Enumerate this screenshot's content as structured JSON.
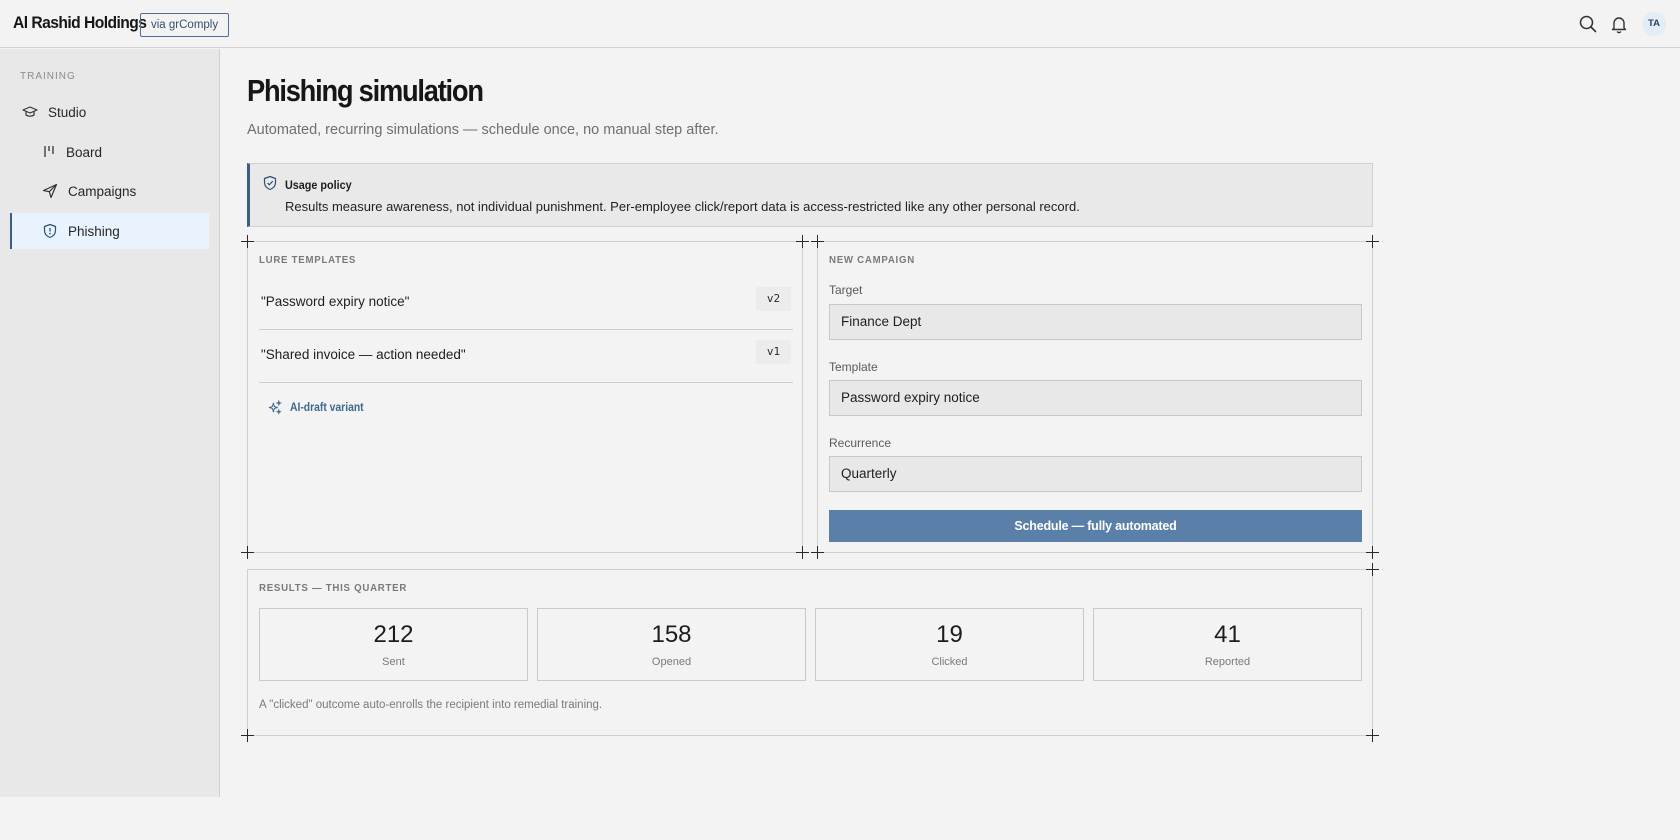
{
  "header": {
    "brand": "Al Rashid Holdings",
    "via_label": "via grComply",
    "avatar_initials": "TA",
    "icons": [
      "search-icon",
      "bell-icon"
    ]
  },
  "sidebar": {
    "section_label": "TRAINING",
    "items": [
      {
        "label": "Studio",
        "icon": "graduation-cap-icon"
      },
      {
        "label": "Board",
        "icon": "kanban-icon"
      },
      {
        "label": "Campaigns",
        "icon": "send-icon"
      },
      {
        "label": "Phishing",
        "icon": "shield-alert-icon",
        "active": true
      }
    ]
  },
  "main": {
    "title": "Phishing simulation",
    "subtitle": "Automated, recurring simulations — schedule once, no manual step after.",
    "policy": {
      "title": "Usage policy",
      "text": "Results measure awareness, not individual punishment. Per-employee click/report data is access-restricted like any other personal record."
    },
    "lure_templates": {
      "heading": "LURE TEMPLATES",
      "items": [
        {
          "name": "\"Password expiry notice\"",
          "version": "v2"
        },
        {
          "name": "\"Shared invoice — action needed\"",
          "version": "v1"
        }
      ],
      "ai_draft_label": "AI-draft variant"
    },
    "new_campaign": {
      "heading": "NEW CAMPAIGN",
      "target_label": "Target",
      "target_value": "Finance Dept",
      "template_label": "Template",
      "template_value": "Password expiry notice",
      "recurrence_label": "Recurrence",
      "recurrence_value": "Quarterly",
      "schedule_button": "Schedule — fully automated"
    },
    "results": {
      "heading": "RESULTS — THIS QUARTER",
      "stats": [
        {
          "value": "212",
          "label": "Sent"
        },
        {
          "value": "158",
          "label": "Opened"
        },
        {
          "value": "19",
          "label": "Clicked"
        },
        {
          "value": "41",
          "label": "Reported"
        }
      ],
      "note": "A \"clicked\" outcome auto-enrolls the recipient into remedial training."
    }
  },
  "colors": {
    "accent": "#3a5f86",
    "button": "#5a80aa",
    "active_bg": "#e9f3fd"
  }
}
